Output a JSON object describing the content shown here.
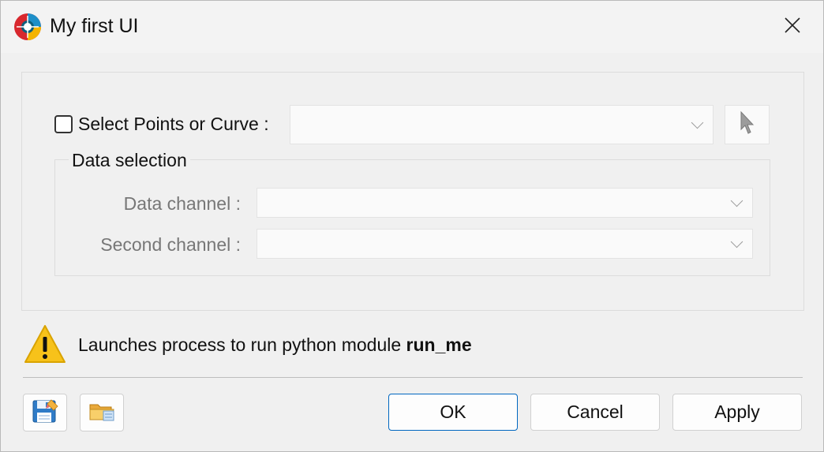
{
  "window": {
    "title": "My first UI"
  },
  "selection": {
    "label": "Select Points or Curve :",
    "checked": false,
    "value": ""
  },
  "data_selection": {
    "title": "Data selection",
    "data_channel_label": "Data channel :",
    "data_channel_value": "",
    "second_channel_label": "Second channel :",
    "second_channel_value": ""
  },
  "message": {
    "text": "Launches process to run python module ",
    "module": "run_me"
  },
  "buttons": {
    "ok": "OK",
    "cancel": "Cancel",
    "apply": "Apply"
  },
  "icons": {
    "app": "app-logo-icon",
    "close": "close-icon",
    "pick": "cursor-arrow-icon",
    "warning": "warning-icon",
    "save": "save-icon",
    "open": "open-folder-icon"
  },
  "colors": {
    "accent": "#0067c0",
    "warning": "#f7c21a"
  }
}
